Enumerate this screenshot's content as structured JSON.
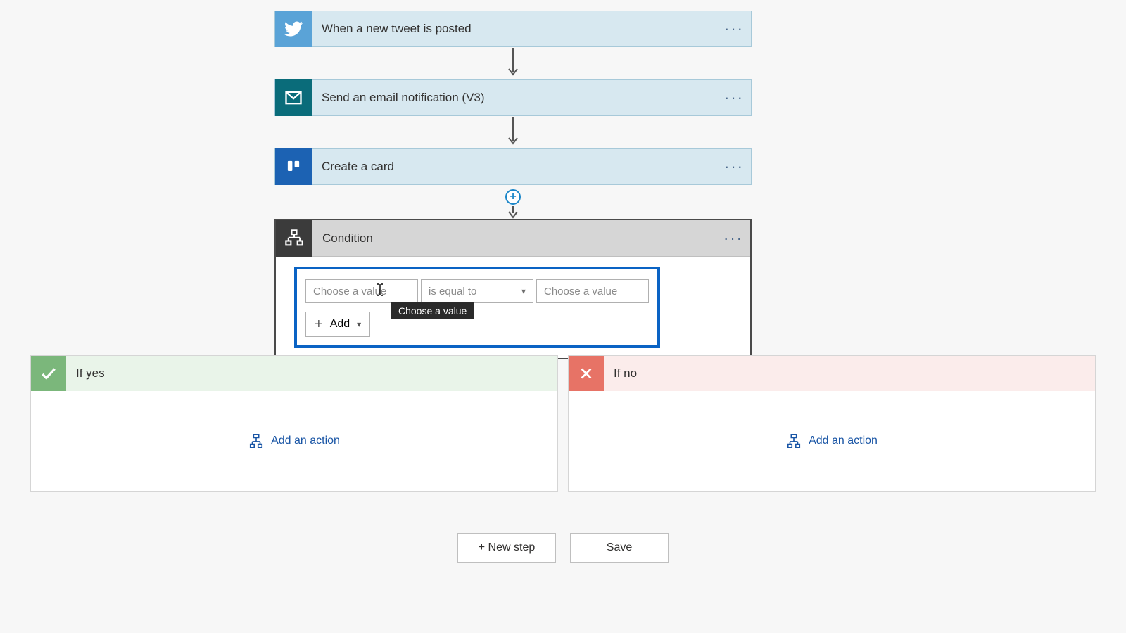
{
  "steps": [
    {
      "title": "When a new tweet is posted",
      "icon": "twitter"
    },
    {
      "title": "Send an email notification (V3)",
      "icon": "mail"
    },
    {
      "title": "Create a card",
      "icon": "trello"
    }
  ],
  "condition": {
    "title": "Condition",
    "left_placeholder": "Choose a value",
    "operator_label": "is equal to",
    "right_placeholder": "Choose a value",
    "add_label": "Add",
    "tooltip": "Choose a value"
  },
  "branches": {
    "yes_label": "If yes",
    "no_label": "If no",
    "add_action_label": "Add an action"
  },
  "bottom": {
    "new_step": "+ New step",
    "save": "Save"
  }
}
